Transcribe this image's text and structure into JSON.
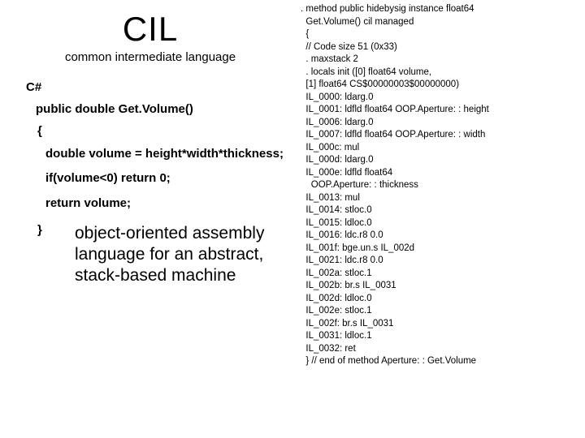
{
  "left": {
    "title": "CIL",
    "subtitle": "common intermediate language",
    "csharp_heading": "C#",
    "csharp_signature": "public double Get.Volume()",
    "brace_open": "{",
    "body_line1": "double volume = height*width*thickness;",
    "body_line2": "if(volume<0)  return 0;",
    "body_line3": "return volume;",
    "brace_close": "}",
    "description": "object-oriented assembly language for an abstract, stack-based machine"
  },
  "right": {
    "lines": [
      ". method public hidebysig instance float64",
      "  Get.Volume() cil managed",
      "  {",
      "  // Code size 51 (0x33)",
      "  . maxstack 2",
      "  . locals init ([0] float64 volume,",
      "  [1] float64 CS$00000003$00000000)",
      "  IL_0000: ldarg.0",
      "  IL_0001: ldfld float64 OOP.Aperture: : height",
      "  IL_0006: ldarg.0",
      "  IL_0007: ldfld float64 OOP.Aperture: : width",
      "  IL_000c: mul",
      "  IL_000d: ldarg.0",
      "  IL_000e: ldfld float64",
      "    OOP.Aperture: : thickness",
      "  IL_0013: mul",
      "  IL_0014: stloc.0",
      "  IL_0015: ldloc.0",
      "  IL_0016: ldc.r8 0.0",
      "  IL_001f: bge.un.s IL_002d",
      "  IL_0021: ldc.r8 0.0",
      "  IL_002a: stloc.1",
      "  IL_002b: br.s IL_0031",
      "  IL_002d: ldloc.0",
      "  IL_002e: stloc.1",
      "  IL_002f: br.s IL_0031",
      "  IL_0031: ldloc.1",
      "  IL_0032: ret",
      "  } // end of method Aperture: : Get.Volume"
    ]
  }
}
